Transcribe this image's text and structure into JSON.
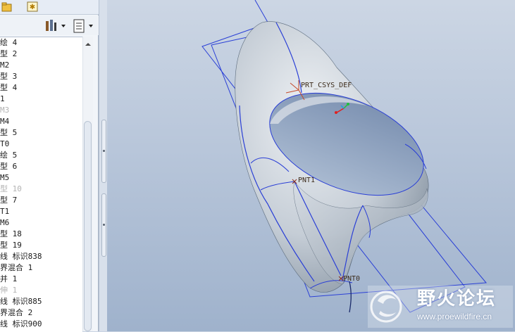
{
  "model_tree": {
    "items": [
      {
        "label": "绘 4",
        "dim": false
      },
      {
        "label": "型 2",
        "dim": false
      },
      {
        "label": "M2",
        "dim": false
      },
      {
        "label": "型 3",
        "dim": false
      },
      {
        "label": "型 4",
        "dim": false
      },
      {
        "label": "1",
        "dim": false
      },
      {
        "label": "M3",
        "dim": true
      },
      {
        "label": "M4",
        "dim": false
      },
      {
        "label": "型 5",
        "dim": false
      },
      {
        "label": "T0",
        "dim": false
      },
      {
        "label": "绘 5",
        "dim": false
      },
      {
        "label": "型 6",
        "dim": false
      },
      {
        "label": "M5",
        "dim": false
      },
      {
        "label": "型 10",
        "dim": true
      },
      {
        "label": "型 7",
        "dim": false
      },
      {
        "label": "T1",
        "dim": false
      },
      {
        "label": "M6",
        "dim": false
      },
      {
        "label": "型 18",
        "dim": false
      },
      {
        "label": "型 19",
        "dim": false
      },
      {
        "label": "线 标识838",
        "dim": false
      },
      {
        "label": "界混合 1",
        "dim": false
      },
      {
        "label": "并 1",
        "dim": false
      },
      {
        "label": "伸 1",
        "dim": true
      },
      {
        "label": "线 标识885",
        "dim": false
      },
      {
        "label": "界混合 2",
        "dim": false
      },
      {
        "label": "线 标识900",
        "dim": false
      }
    ]
  },
  "viewport": {
    "labels": {
      "csys": "PRT_CSYS_DEF",
      "pnt1": "PNT1",
      "pnt0": "PNT0"
    }
  },
  "watermark": {
    "title": "野火论坛",
    "url": "www.proewildfire.cn"
  },
  "colors": {
    "plane_edge": "#2a3fd6",
    "surface": "#c8d0d8",
    "label_text": "#3b2a1a"
  }
}
